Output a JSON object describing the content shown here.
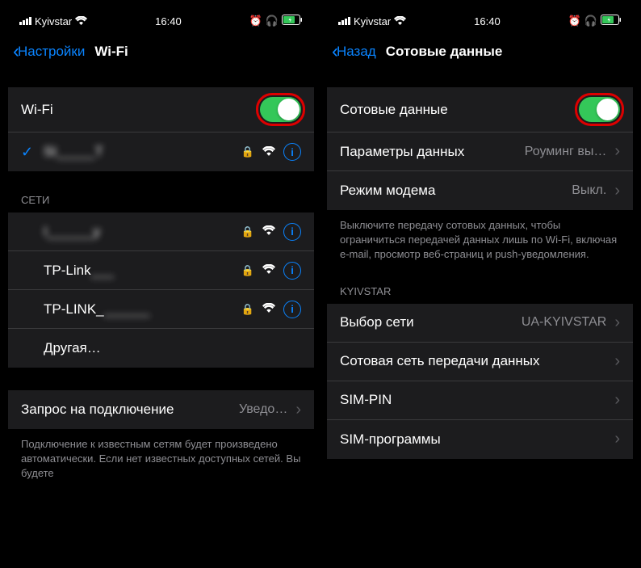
{
  "left": {
    "status": {
      "carrier": "Kyivstar",
      "time": "16:40"
    },
    "nav": {
      "back": "Настройки",
      "title": "Wi-Fi"
    },
    "wifi_label": "Wi-Fi",
    "connected_network": "SI_____T",
    "section_networks": "СЕТИ",
    "networks": [
      "I______y",
      "TP-Link___",
      "TP-LINK_______"
    ],
    "other_label": "Другая…",
    "ask_to_join_label": "Запрос на подключение",
    "ask_to_join_value": "Уведо…",
    "footer": "Подключение к известным сетям будет произведено автоматически. Если нет известных доступных сетей. Вы будете"
  },
  "right": {
    "status": {
      "carrier": "Kyivstar",
      "time": "16:40"
    },
    "nav": {
      "back": "Назад",
      "title": "Сотовые данные"
    },
    "cellular_label": "Сотовые данные",
    "data_options_label": "Параметры данных",
    "data_options_value": "Роуминг вы…",
    "hotspot_label": "Режим модема",
    "hotspot_value": "Выкл.",
    "footer1": "Выключите передачу сотовых данных, чтобы ограничиться передачей данных лишь по Wi-Fi, включая e-mail, просмотр веб-страниц и push-уведомления.",
    "carrier_section": "KYIVSTAR",
    "network_sel_label": "Выбор сети",
    "network_sel_value": "UA-KYIVSTAR",
    "cellular_net_label": "Сотовая сеть передачи данных",
    "sim_pin_label": "SIM-PIN",
    "sim_apps_label": "SIM-программы"
  }
}
